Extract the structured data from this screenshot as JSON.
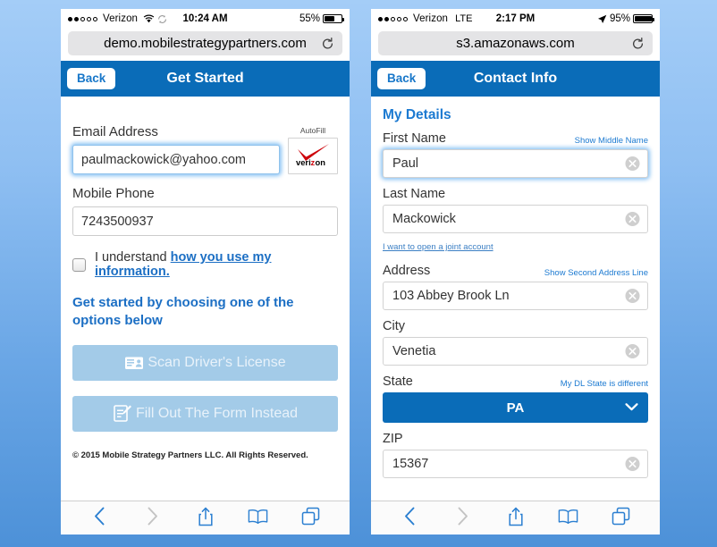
{
  "phones": [
    {
      "id": "left",
      "status": {
        "signal_dots_filled": 2,
        "signal_dots_total": 5,
        "carrier": "Verizon",
        "network": "",
        "time": "10:24 AM",
        "battery_percent": "55%",
        "battery_level": 55,
        "wifi_icon": "wifi-icon",
        "location_icon": "",
        "sync_icon": "sync-icon"
      },
      "browser": {
        "url": "demo.mobilestrategypartners.com",
        "reload_icon": "reload-icon"
      },
      "nav": {
        "back_label": "Back",
        "title": "Get Started"
      },
      "form": {
        "email_label": "Email Address",
        "email_value": "paulmackowick@yahoo.com",
        "email_placeholder": "Email Address",
        "autofill_label": "AutoFill",
        "autofill_brand": "verizon",
        "phone_label": "Mobile Phone",
        "phone_value": "7243500937",
        "phone_placeholder": "Mobile Phone",
        "consent_text": "I understand ",
        "consent_link": "how you use my information.",
        "promo_text": "Get started by choosing one of the options below",
        "scan_button": "Scan Driver's License",
        "scan_icon": "id-card-icon",
        "form_button": "Fill Out The Form Instead",
        "form_icon": "clipboard-pencil-icon",
        "copyright": "© 2015 Mobile Strategy Partners LLC. All Rights Reserved."
      },
      "toolbar": {
        "back_icon": "chevron-left-icon",
        "forward_icon": "chevron-right-icon",
        "share_icon": "share-icon",
        "bookmarks_icon": "book-icon",
        "tabs_icon": "tabs-icon"
      }
    },
    {
      "id": "right",
      "status": {
        "signal_dots_filled": 2,
        "signal_dots_total": 5,
        "carrier": "Verizon",
        "network": "LTE",
        "time": "2:17 PM",
        "battery_percent": "95%",
        "battery_level": 95,
        "wifi_icon": "",
        "location_icon": "location-arrow-icon",
        "sync_icon": ""
      },
      "browser": {
        "url": "s3.amazonaws.com",
        "reload_icon": "reload-icon"
      },
      "nav": {
        "back_label": "Back",
        "title": "Contact Info"
      },
      "form": {
        "section_title": "My Details",
        "fields": [
          {
            "label": "First Name",
            "value": "Paul",
            "action_link": "Show Middle Name",
            "clear_icon": "clear-circle-icon",
            "focused": true
          },
          {
            "label": "Last Name",
            "value": "Mackowick",
            "action_link": "",
            "clear_icon": "clear-circle-icon",
            "focused": false
          }
        ],
        "joint_link": "I want to open a joint account",
        "address_fields": [
          {
            "label": "Address",
            "value": "103 Abbey Brook Ln",
            "action_link": "Show Second Address Line",
            "clear_icon": "clear-circle-icon"
          },
          {
            "label": "City",
            "value": "Venetia",
            "action_link": "",
            "clear_icon": "clear-circle-icon"
          }
        ],
        "state_label": "State",
        "state_link": "My DL State is different",
        "state_value": "PA",
        "state_chevron": "chevron-down-icon",
        "zip_label": "ZIP",
        "zip_value": "15367",
        "zip_clear_icon": "clear-circle-icon"
      },
      "toolbar": {
        "back_icon": "chevron-left-icon",
        "forward_icon": "chevron-right-icon",
        "share_icon": "share-icon",
        "bookmarks_icon": "book-icon",
        "tabs_icon": "tabs-icon"
      }
    }
  ],
  "colors": {
    "nav_blue": "#0a6cb8",
    "link_blue": "#1c7ad1",
    "disabled_button": "#a3cbe8",
    "page_background_top": "#a4cdf7",
    "page_background_bottom": "#4d91d8",
    "verizon_red": "#cd040b"
  }
}
